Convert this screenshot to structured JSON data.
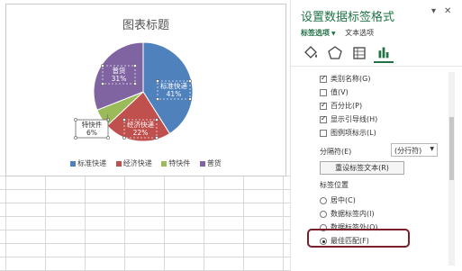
{
  "chart": {
    "title": "图表标题",
    "legend": [
      {
        "label": "标准快递",
        "color": "#4f81bd"
      },
      {
        "label": "经济快递",
        "color": "#c0504d"
      },
      {
        "label": "特快件",
        "color": "#9bbb59"
      },
      {
        "label": "普货",
        "color": "#8064a2"
      }
    ]
  },
  "chart_data": {
    "type": "pie",
    "title": "图表标题",
    "categories": [
      "标准快递",
      "经济快递",
      "特快件",
      "普货"
    ],
    "values": [
      41,
      22,
      6,
      31
    ],
    "data_labels": [
      {
        "category": "标准快递",
        "percent": "41%"
      },
      {
        "category": "经济快递",
        "percent": "22%"
      },
      {
        "category": "特快件",
        "percent": "6%"
      },
      {
        "category": "普货",
        "percent": "31%"
      }
    ],
    "colors": [
      "#4f81bd",
      "#c0504d",
      "#9bbb59",
      "#8064a2"
    ],
    "legend": "bottom"
  },
  "pane": {
    "title": "设置数据标签格式",
    "tabs": {
      "label_options": "标签选项",
      "text_options": "文本选项"
    },
    "icons": [
      "fill-icon",
      "pentagon-icon",
      "size-properties-icon",
      "bar-chart-icon"
    ],
    "label_contains": [
      {
        "label": "类别名称(G)",
        "checked": true
      },
      {
        "label": "值(V)",
        "checked": false
      },
      {
        "label": "百分比(P)",
        "checked": true
      },
      {
        "label": "显示引导线(H)",
        "checked": true
      },
      {
        "label": "图例项标示(L)",
        "checked": false
      }
    ],
    "separator_label": "分隔符(E)",
    "separator_value": "(分行符)",
    "reset_button": "重设标签文本(R)",
    "position_section": "标签位置",
    "positions": [
      {
        "label": "居中(C)",
        "checked": false
      },
      {
        "label": "数据标签内(I)",
        "checked": false
      },
      {
        "label": "数据标签外(O)",
        "checked": false
      },
      {
        "label": "最佳匹配(F)",
        "checked": true
      }
    ],
    "accent_color": "#217346",
    "highlight_color": "#7a1f2b"
  }
}
